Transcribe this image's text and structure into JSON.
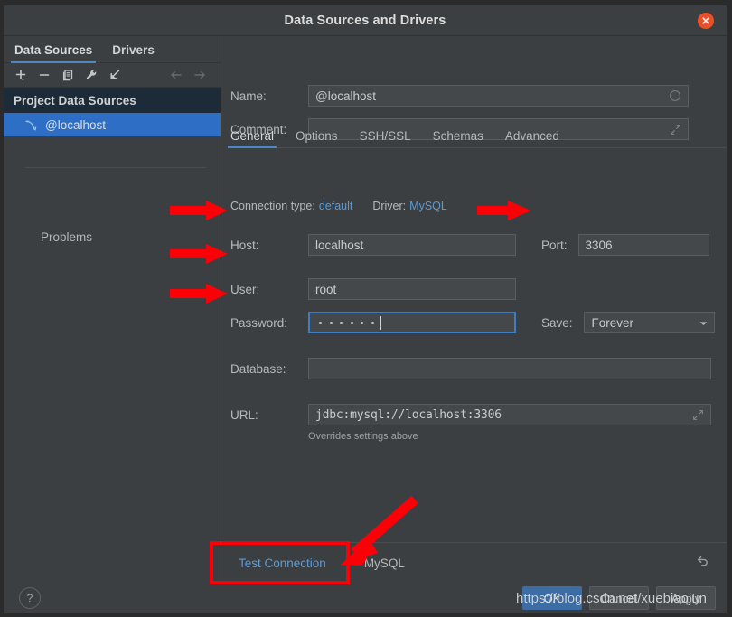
{
  "window": {
    "title": "Data Sources and Drivers",
    "close_icon": "close-icon"
  },
  "left_panel": {
    "tabs": [
      {
        "label": "Data Sources",
        "active": true
      },
      {
        "label": "Drivers",
        "active": false
      }
    ],
    "toolbar": [
      {
        "name": "add-icon",
        "glyph": "+"
      },
      {
        "name": "remove-icon",
        "glyph": "−"
      },
      {
        "name": "copy-icon",
        "glyph": "copy"
      },
      {
        "name": "properties-wrench-icon",
        "glyph": "wrench"
      },
      {
        "name": "import-icon",
        "glyph": "import-arrow"
      },
      {
        "name": "back-arrow-icon",
        "glyph": "←"
      },
      {
        "name": "forward-arrow-icon",
        "glyph": "→"
      }
    ],
    "group_header": "Project Data Sources",
    "selected_item": {
      "label": "@localhost",
      "icon": "mysql-dolphin-icon"
    },
    "problems_label": "Problems"
  },
  "form": {
    "name_label": "Name:",
    "name_value": "@localhost",
    "name_field_icon": "circle-icon",
    "comment_label": "Comment:",
    "comment_value": "",
    "comment_placeholder": "",
    "comment_field_icon": "expand-icon",
    "tabs": [
      {
        "label": "General",
        "active": true
      },
      {
        "label": "Options",
        "active": false
      },
      {
        "label": "SSH/SSL",
        "active": false
      },
      {
        "label": "Schemas",
        "active": false
      },
      {
        "label": "Advanced",
        "active": false
      }
    ],
    "connection_type_label": "Connection type:",
    "connection_type_value": "default",
    "driver_label": "Driver:",
    "driver_value": "MySQL",
    "host_label": "Host:",
    "host_value": "localhost",
    "port_label": "Port:",
    "port_value": "3306",
    "user_label": "User:",
    "user_value": "root",
    "password_label": "Password:",
    "password_masked": "••••••",
    "password_dot_count": 6,
    "save_label": "Save:",
    "save_value": "Forever",
    "save_options": [
      "Forever"
    ],
    "database_label": "Database:",
    "database_value": "",
    "url_label": "URL:",
    "url_value": "jdbc:mysql://localhost:3306",
    "url_field_icon": "expand-icon",
    "url_hint": "Overrides settings above"
  },
  "bottom_bar": {
    "test_connection_label": "Test Connection",
    "driver_name": "MySQL",
    "revert_icon": "revert-arrow-icon"
  },
  "footer": {
    "help_label": "?",
    "buttons": [
      {
        "label": "OK",
        "primary": true
      },
      {
        "label": "Cancel",
        "primary": false
      },
      {
        "label": "Apply",
        "primary": false
      }
    ]
  },
  "annotations": {
    "watermark_text": "https://blog.csdn.net/xuebiaojun",
    "arrow_color": "#fb0007",
    "highlight_box_color": "#fb0007"
  },
  "colors": {
    "window_bg": "#3c3f41",
    "accent_blue": "#4a88c7",
    "link_blue": "#5b9bd5",
    "selection_blue": "#2f6ec5",
    "group_header_bg": "#1d2a37",
    "close_red": "#e8502a"
  }
}
